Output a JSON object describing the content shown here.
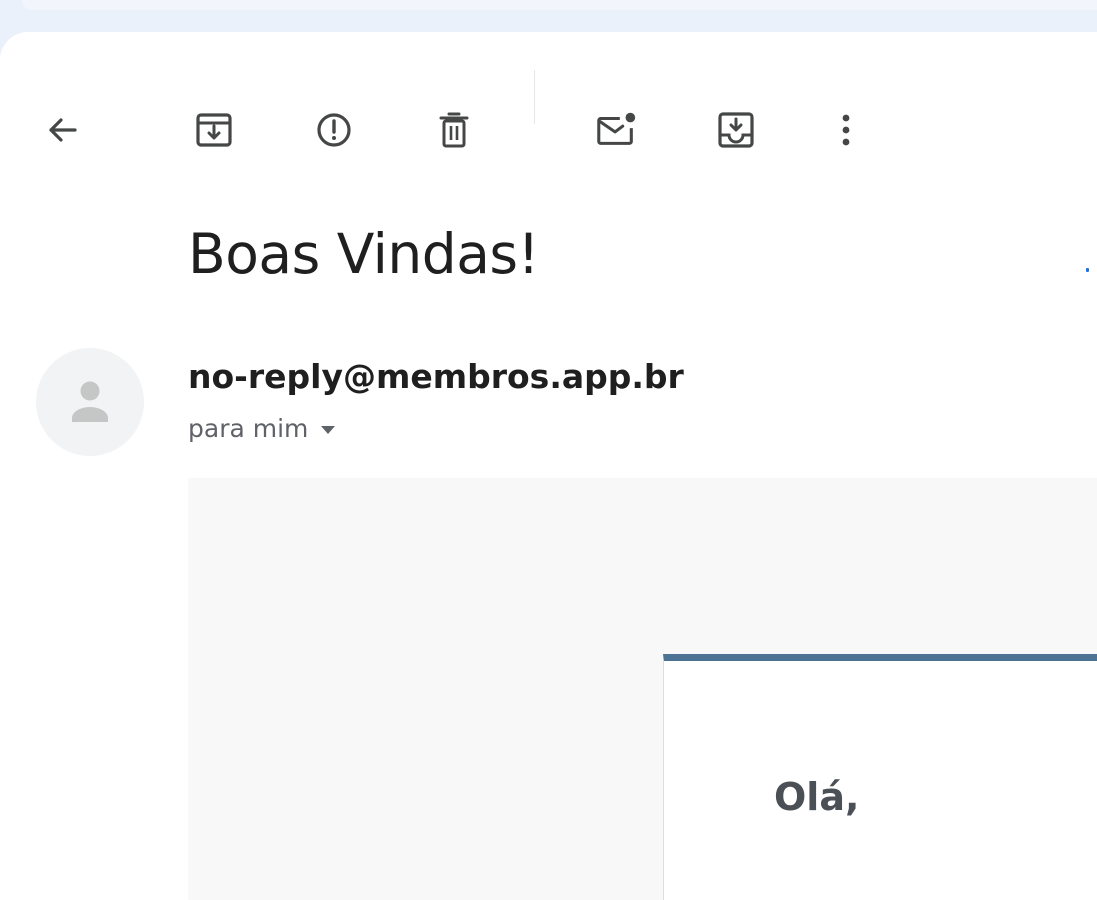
{
  "toolbar": {
    "buttons": [
      {
        "name": "back",
        "icon": "arrow-left-icon"
      },
      {
        "name": "archive",
        "icon": "archive-icon"
      },
      {
        "name": "report-spam",
        "icon": "report-spam-icon"
      },
      {
        "name": "delete",
        "icon": "trash-icon"
      },
      {
        "name": "mark-unread",
        "icon": "mark-unread-icon"
      },
      {
        "name": "move-to",
        "icon": "move-to-inbox-icon"
      },
      {
        "name": "more",
        "icon": "more-vert-icon"
      }
    ]
  },
  "message": {
    "subject": "Boas Vindas!",
    "sender": "no-reply@membros.app.br",
    "recipient_label": "para mim",
    "body": {
      "greeting": "Olá,"
    }
  },
  "colors": {
    "icon": "#444746",
    "text_primary": "#1f1f1f",
    "text_secondary": "#5f6368",
    "card_accent": "#4c7393",
    "email_background": "#f8f8f8",
    "shell_background": "#eaf1fb"
  }
}
